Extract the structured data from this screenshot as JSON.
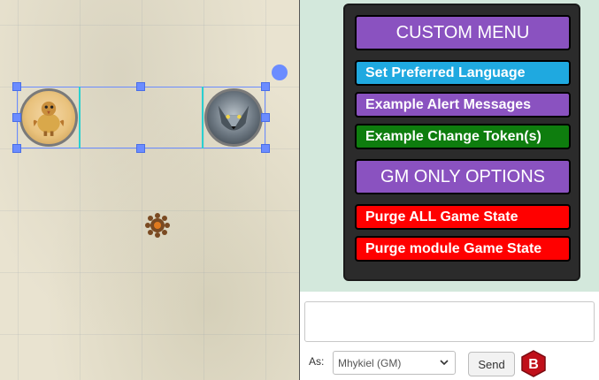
{
  "map": {
    "tokens": [
      {
        "name": "bird-token"
      },
      {
        "name": "wolf-token"
      }
    ]
  },
  "menu": {
    "header": "CUSTOM MENU",
    "items": [
      {
        "label": "Set Preferred Language",
        "color": "#1fa9e0"
      },
      {
        "label": "Example Alert Messages",
        "color": "#8a52c0"
      },
      {
        "label": "Example Change Token(s)",
        "color": "#0e7d0e"
      }
    ],
    "gm_header": "GM ONLY OPTIONS",
    "gm_items": [
      {
        "label": "Purge ALL Game State",
        "color": "#ff0000"
      },
      {
        "label": "Purge module Game State",
        "color": "#ff0000"
      }
    ]
  },
  "chat": {
    "as_label": "As:",
    "as_value": "Mhykiel (GM)",
    "send_label": "Send",
    "b_icon_letter": "B"
  },
  "colors": {
    "chat_background": "#d3e8dc",
    "selection": "#6b8cff",
    "menu_purple": "#8a52c0"
  }
}
